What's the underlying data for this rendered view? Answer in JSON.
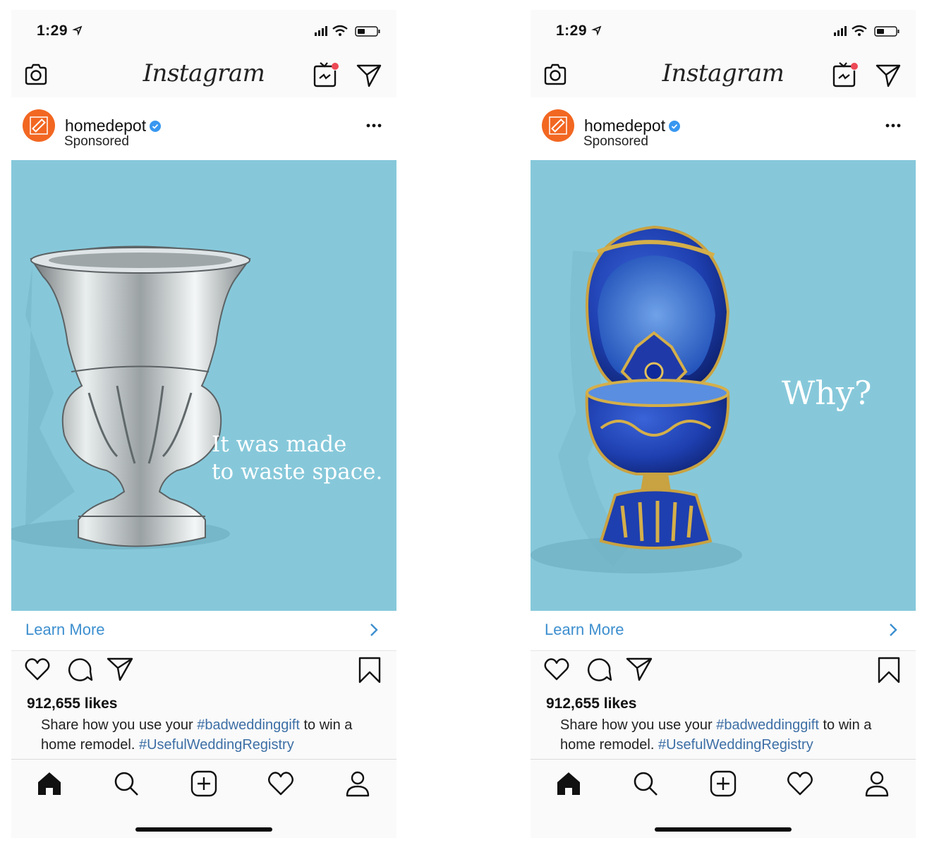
{
  "screens": [
    {
      "status_bar": {
        "time": "1:29"
      },
      "top_bar": {
        "wordmark": "Instagram"
      },
      "post": {
        "username": "homedepot",
        "sponsored_label": "Sponsored",
        "ad_text_line1": "It was made",
        "ad_text_line2": "to waste space.",
        "product": "crystal urn vase",
        "cta_label": "Learn More",
        "likes": "912,655 likes",
        "caption_text1": "Share how you use your ",
        "caption_hashtag1": "#badweddinggift",
        "caption_text2": " to win a home remodel. ",
        "caption_hashtag2": "#UsefulWeddingRegistry"
      }
    },
    {
      "status_bar": {
        "time": "1:29"
      },
      "top_bar": {
        "wordmark": "Instagram"
      },
      "post": {
        "username": "homedepot",
        "sponsored_label": "Sponsored",
        "ad_text_line1": "Why?",
        "product": "jeweled blue egg trinket box",
        "cta_label": "Learn More",
        "likes": "912,655 likes",
        "caption_text1": "Share how you use your ",
        "caption_hashtag1": "#badweddinggift",
        "caption_text2": " to win a home remodel. ",
        "caption_hashtag2": "#UsefulWeddingRegistry"
      }
    }
  ],
  "colors": {
    "ad_background": "#86c8da",
    "cta_blue": "#3d8fcf",
    "hashtag_blue": "#3d6fa6",
    "verified_blue": "#3897f0",
    "brand_orange": "#f26722",
    "notification_red": "#ed4956"
  },
  "icons": [
    "camera-icon",
    "igtv-icon",
    "direct-icon",
    "verified-icon",
    "more-icon",
    "chevron-right-icon",
    "heart-icon",
    "comment-icon",
    "share-icon",
    "bookmark-icon",
    "home-icon",
    "search-icon",
    "add-icon",
    "activity-icon",
    "profile-icon"
  ]
}
